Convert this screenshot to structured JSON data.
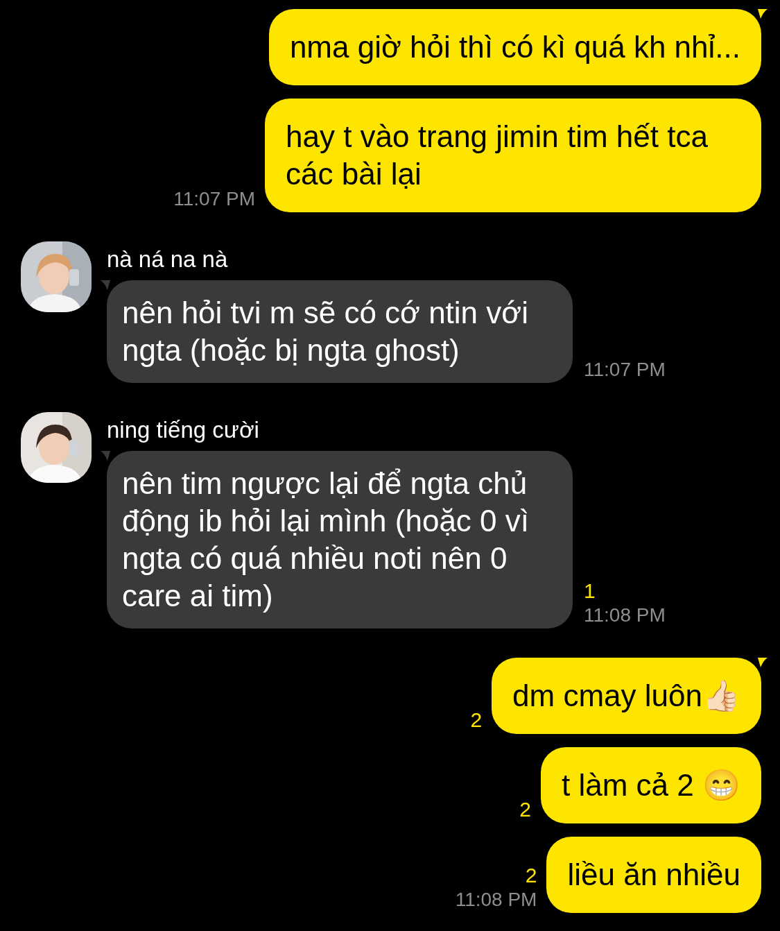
{
  "messages": [
    {
      "kind": "sent",
      "tail": true,
      "text": "nma giờ hỏi thì có kì quá kh nhỉ..."
    },
    {
      "kind": "sent",
      "tail": false,
      "text": "hay t vào trang jimin tim hết tca các bài lại",
      "time": "11:07 PM"
    },
    {
      "kind": "received",
      "tail": true,
      "sender": "nà ná na nà",
      "text": "nên hỏi tvi m sẽ có cớ ntin với ngta (hoặc bị ngta ghost)",
      "time": "11:07 PM"
    },
    {
      "kind": "received",
      "tail": true,
      "sender": "ning tiếng cười",
      "text": "nên tim ngược lại để ngta chủ động ib hỏi lại mình (hoặc 0 vì ngta có quá nhiều noti nên 0 care ai tim)",
      "unread": "1",
      "time": "11:08 PM"
    },
    {
      "kind": "sent",
      "tail": true,
      "text": "dm cmay luôn👍🏻",
      "unread": "2"
    },
    {
      "kind": "sent",
      "tail": false,
      "text": "t làm cả 2 😁",
      "unread": "2"
    },
    {
      "kind": "sent",
      "tail": false,
      "text": "liều ăn nhiều",
      "unread": "2",
      "time": "11:08 PM"
    }
  ]
}
